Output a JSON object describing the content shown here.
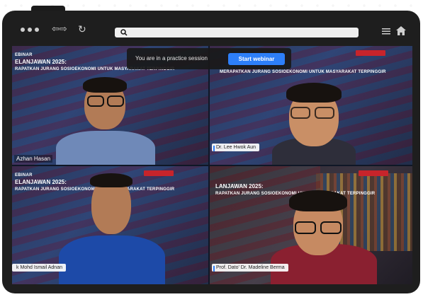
{
  "browser": {
    "address_value": "",
    "icons": [
      "window-dots-icon",
      "back-forward-arrows-icon",
      "reload-icon",
      "search-icon",
      "menu-icon",
      "home-icon"
    ]
  },
  "practice_banner": {
    "message": "You are in a practice session",
    "button_label": "Start webinar",
    "button_color": "#2d7ff9"
  },
  "webinar": {
    "banner_small": "EBINAR",
    "banner_title": "ELANJAWAN 2025:",
    "banner_subtitle": "RAPATKAN JURANG SOSIOEKONOMI UNTUK MASYARAKAT TERPINGGIR",
    "banner_title_full": "ELANJAWAN 2025:",
    "tr_banner_subtitle": "MERAPATKAN JURANG SOSIOEKONOMI UNTUK MASYARAKAT TERPINGGIR",
    "br_banner_title": "LANJAWAN 2025:",
    "br_banner_subtitle": "RAPATKAN JURANG SOSIOEKONOMI UNTUK MASYARAKAT TERPINGGIR"
  },
  "participants": [
    {
      "name": "Azhan Hasan"
    },
    {
      "name": "Dr. Lee Hwok Aun"
    },
    {
      "name": "k Mohd Ismail Adnan"
    },
    {
      "name": "Prof. Dato' Dr. Madeline Berma"
    }
  ],
  "colors": {
    "frame": "#1e1e1e",
    "accent": "#2d7ff9",
    "logo_red": "#c7242b"
  }
}
